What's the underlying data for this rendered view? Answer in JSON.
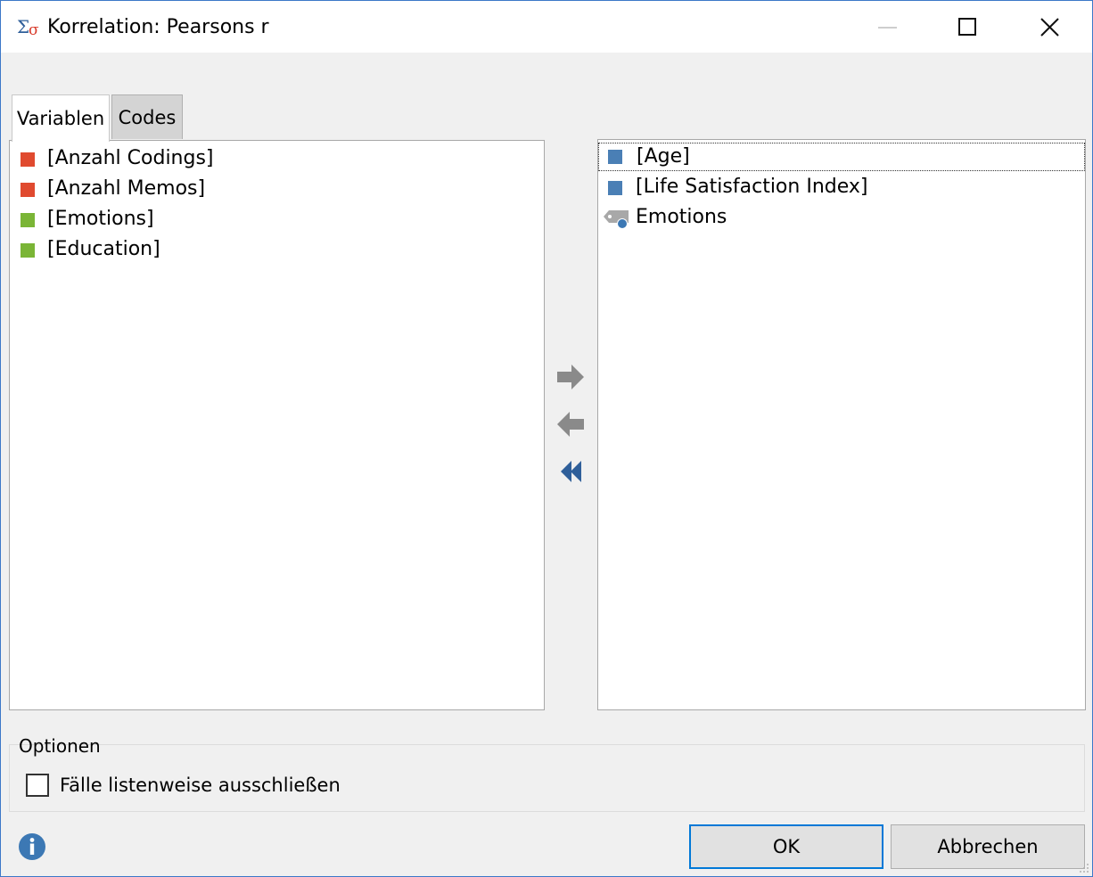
{
  "window": {
    "title": "Korrelation: Pearsons r"
  },
  "tabs": [
    {
      "label": "Variablen",
      "active": true
    },
    {
      "label": "Codes",
      "active": false
    }
  ],
  "available_list": {
    "items": [
      {
        "label": "[Anzahl Codings]",
        "color": "#e04a2f"
      },
      {
        "label": "[Anzahl Memos]",
        "color": "#e04a2f"
      },
      {
        "label": "[Emotions]",
        "color": "#7ab536"
      },
      {
        "label": "[Education]",
        "color": "#7ab536"
      }
    ]
  },
  "selected_list": {
    "items": [
      {
        "label": "[Age]",
        "color": "#4a7fb5",
        "icon": "variable-square-icon"
      },
      {
        "label": "[Life Satisfaction Index]",
        "color": "#4a7fb5",
        "icon": "variable-square-icon"
      },
      {
        "label": "Emotions",
        "color": "#9a9a9a",
        "icon": "code-tag-icon"
      }
    ]
  },
  "transfer_buttons": {
    "add": "arrow-right-icon",
    "remove": "arrow-left-icon",
    "remove_all": "double-chevron-left-icon"
  },
  "options": {
    "group_label": "Optionen",
    "listwise_exclude_label": "Fälle listenweise ausschließen",
    "listwise_exclude_checked": false
  },
  "footer": {
    "ok_label": "OK",
    "cancel_label": "Abbrechen"
  }
}
